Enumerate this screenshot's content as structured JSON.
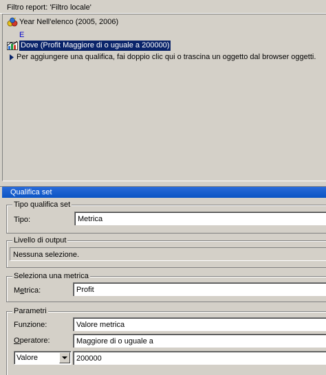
{
  "report": {
    "title": "Filtro report: 'Filtro locale'",
    "rows": [
      {
        "icon": "attribute-qualification-icon",
        "text": "Year Nell'elenco (2005, 2006)"
      },
      {
        "conjunction": "E"
      },
      {
        "icon": "metric-qualification-icon",
        "text": "Dove (Profit Maggiore di o uguale a 200000)",
        "selected": true
      },
      {
        "icon": "arrow-right-icon",
        "text": "Per aggiungere una qualifica, fai doppio clic qui o trascina un oggetto dal browser oggetti."
      }
    ]
  },
  "qualifica": {
    "header": "Qualifica set",
    "tipo_group": {
      "title": "Tipo qualifica set",
      "label": "Tipo:",
      "value": "Metrica"
    },
    "livello_group": {
      "title": "Livello di output",
      "value": "Nessuna selezione."
    },
    "metrica_group": {
      "title": "Seleziona una metrica",
      "label_prefix": "M",
      "label_underlined": "e",
      "label_suffix": "trica:",
      "value": "Profit"
    },
    "parametri_group": {
      "title": "Parametri",
      "funzione_label": "Funzione:",
      "funzione_value": "Valore metrica",
      "operatore_label_underlined": "O",
      "operatore_label_rest": "peratore:",
      "operatore_value": "Maggiore di o uguale a",
      "valore_select": "Valore",
      "valore_value": "200000"
    }
  }
}
